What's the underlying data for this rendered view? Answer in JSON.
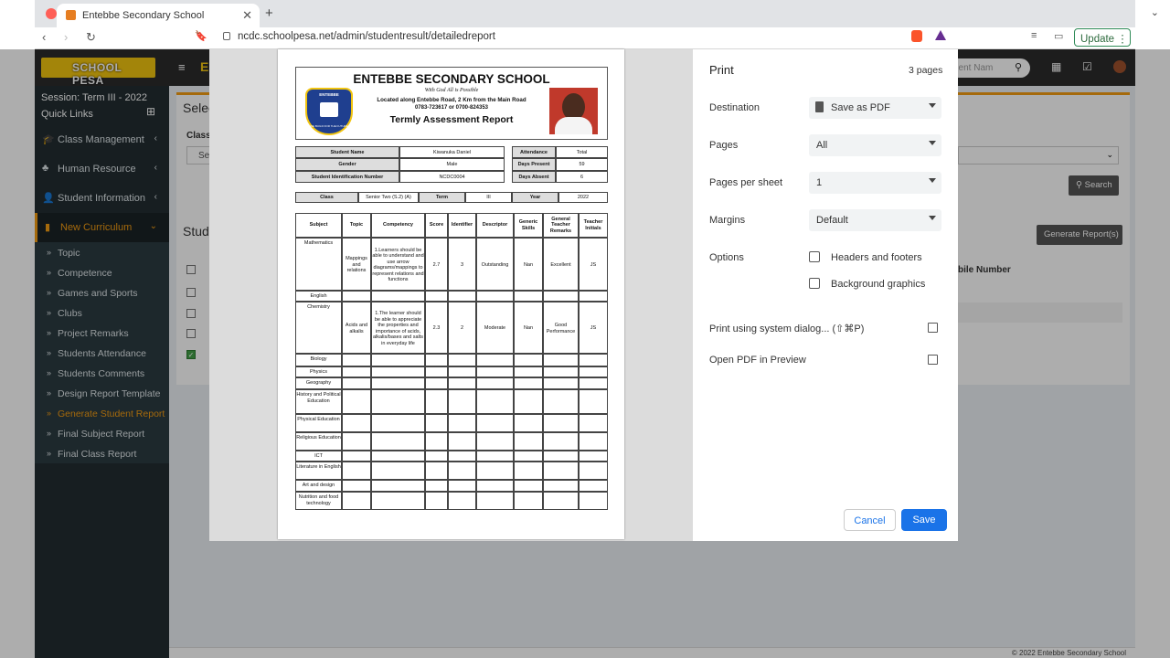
{
  "browser": {
    "tab_title": "Entebbe Secondary School",
    "url": "ncdc.schoolpesa.net/admin/studentresult/detailedreport",
    "update_label": "Update"
  },
  "app": {
    "logo": "SCHOOL PESA",
    "session": "Session: Term III - 2022",
    "quick_links": "Quick Links",
    "search_placeholder": "dent Nam",
    "main_menu": [
      {
        "label": "Class Management",
        "icon": "graduation-cap-icon"
      },
      {
        "label": "Human Resource",
        "icon": "sitemap-icon"
      },
      {
        "label": "Student Information",
        "icon": "user-plus-icon"
      },
      {
        "label": "New Curriculum",
        "icon": "book-icon"
      }
    ],
    "sub_menu": [
      "Topic",
      "Competence",
      "Games and Sports",
      "Clubs",
      "Project Remarks",
      "Students Attendance",
      "Students Comments",
      "Design Report Template",
      "Generate Student Report",
      "Final Subject Report",
      "Final Class Report"
    ],
    "bg_select_heading": "Selec",
    "bg_class_label": "Class",
    "bg_select_value": "Se",
    "bg_students_heading": "Stud",
    "bg_mobile_col": "bile Number",
    "bg_search": "Search",
    "bg_generate": "Generate Report(s)",
    "footer": "© 2022 Entebbe Secondary School",
    "accent": "#f39c12"
  },
  "print": {
    "title": "Print",
    "pages_count": "3 pages",
    "destination_label": "Destination",
    "destination_value": "Save as PDF",
    "pages_label": "Pages",
    "pages_value": "All",
    "pps_label": "Pages per sheet",
    "pps_value": "1",
    "margins_label": "Margins",
    "margins_value": "Default",
    "options_label": "Options",
    "opt_headers": "Headers and footers",
    "opt_background": "Background graphics",
    "system_dialog": "Print using system dialog... (⇧⌘P)",
    "open_pdf": "Open PDF in Preview",
    "cancel": "Cancel",
    "save": "Save",
    "accent": "#1a73e8"
  },
  "report": {
    "school": "ENTEBBE SECONDARY SCHOOL",
    "motto": "With God All is Possible",
    "location": "Located along Entebbe Road, 2 Km from the Main Road",
    "phones": "0783-723617 or 0700-824353",
    "report_title": "Termly Assessment Report",
    "crest_text": "ENTEBBE",
    "crest_motto": "WE BUILD FOR THE FUTURE",
    "student": {
      "name_label": "Student Name",
      "name": "Kiwanuka Daniel",
      "gender_label": "Gender",
      "gender": "Male",
      "id_label": "Student Identification Number",
      "id": "NCDC0004",
      "attendance_label": "Attendance",
      "attendance": "Total",
      "present_label": "Days Present",
      "present": "59",
      "absent_label": "Days Absent",
      "absent": "6"
    },
    "class_row": {
      "class_label": "Class",
      "class": "Senior Two (S.2) (A)",
      "term_label": "Term",
      "term": "III",
      "year_label": "Year",
      "year": "2022"
    },
    "headers": [
      "Subject",
      "Topic",
      "Competency",
      "Score",
      "Identifier",
      "Descriptor",
      "Generic Skills",
      "General Teacher Remarks",
      "Teacher Initials"
    ],
    "rows": [
      {
        "subject": "Mathematics",
        "topic": "Mappings and relations",
        "competency": "1.Learners should be able to understand and use arrow diagrams/mappings to represent relations and functions",
        "score": "2.7",
        "identifier": "3",
        "descriptor": "Outstanding",
        "skills": "Nan",
        "remarks": "Excellent",
        "initials": "JS"
      },
      {
        "subject": "English",
        "topic": "",
        "competency": "",
        "score": "",
        "identifier": "",
        "descriptor": "",
        "skills": "",
        "remarks": "",
        "initials": ""
      },
      {
        "subject": "Chemistry",
        "topic": "Acids and alkalis",
        "competency": "1.The learner should be able to appreciate the properties and importance of acids, alkalis/bases and salts in everyday life",
        "score": "2.3",
        "identifier": "2",
        "descriptor": "Moderate",
        "skills": "Nan",
        "remarks": "Good Performance",
        "initials": "JS"
      },
      {
        "subject": "Biology"
      },
      {
        "subject": "Physics"
      },
      {
        "subject": "Geography"
      },
      {
        "subject": "History and Political Education"
      },
      {
        "subject": "Physical Education"
      },
      {
        "subject": "Religious Education"
      },
      {
        "subject": "ICT"
      },
      {
        "subject": "Literature in English"
      },
      {
        "subject": "Art and design"
      },
      {
        "subject": "Nutrition and food technology"
      }
    ]
  }
}
